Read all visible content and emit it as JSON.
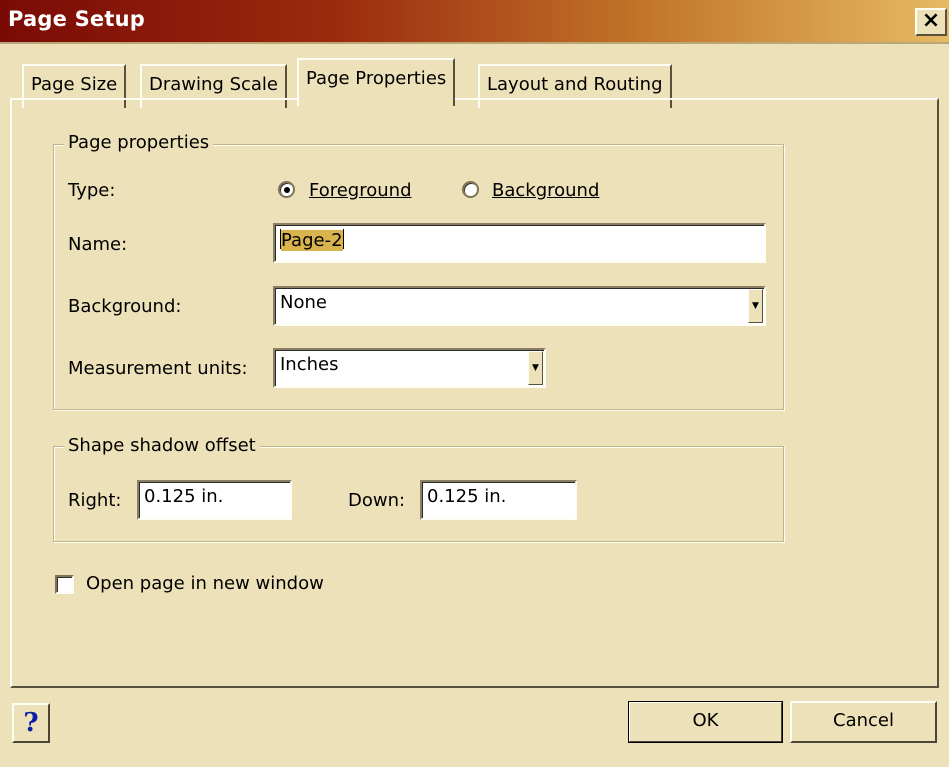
{
  "window": {
    "title": "Page Setup",
    "close_glyph": "×"
  },
  "tabs": [
    {
      "label": "Page Size"
    },
    {
      "label": "Drawing Scale"
    },
    {
      "label": "Page Properties",
      "active": true
    },
    {
      "label": "Layout and Routing"
    }
  ],
  "page_properties": {
    "group_label": "Page properties",
    "type_label": "Type:",
    "type_options": [
      {
        "label": "Foreground",
        "selected": true
      },
      {
        "label": "Background",
        "selected": false
      }
    ],
    "name_label": "Name:",
    "name_value": "Page-2",
    "background_label": "Background:",
    "background_value": "None",
    "units_label": "Measurement units:",
    "units_value": "Inches"
  },
  "shadow_offset": {
    "group_label": "Shape shadow offset",
    "right_label": "Right:",
    "right_value": "0.125 in.",
    "down_label": "Down:",
    "down_value": "0.125 in."
  },
  "open_new_window": {
    "label": "Open page in new window",
    "checked": false
  },
  "buttons": {
    "help": "?",
    "ok": "OK",
    "cancel": "Cancel"
  },
  "colors": {
    "dialog_bg": "#ece1b8",
    "title_start": "#7a0a05",
    "title_end": "#e6ba62",
    "selection": "#d9b34e",
    "help_blue": "#0a1ea6"
  }
}
